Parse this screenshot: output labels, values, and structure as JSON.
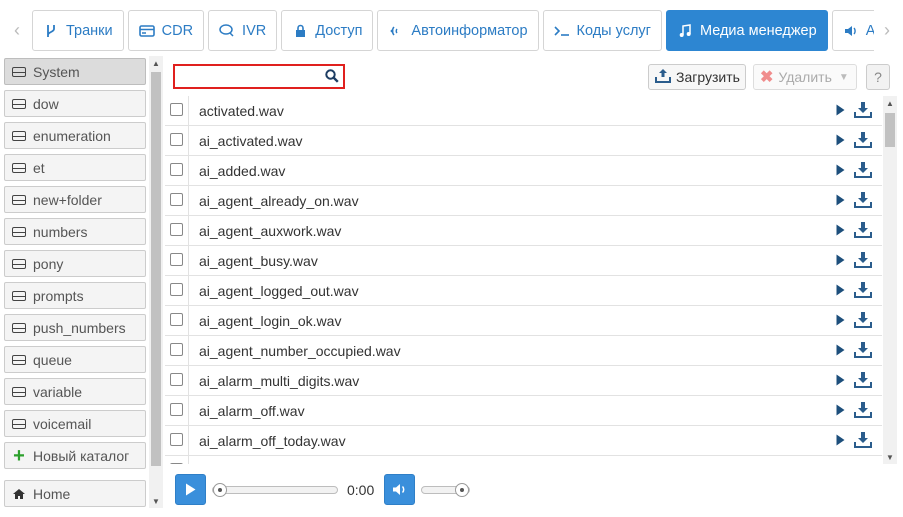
{
  "tabs": [
    {
      "label": "Транки",
      "icon": "fork-icon"
    },
    {
      "label": "CDR",
      "icon": "card-icon"
    },
    {
      "label": "IVR",
      "icon": "chat-icon"
    },
    {
      "label": "Доступ",
      "icon": "lock-icon"
    },
    {
      "label": "Автоинформатор",
      "icon": "phone-wave-icon"
    },
    {
      "label": "Коды услуг",
      "icon": "terminal-icon"
    },
    {
      "label": "Медиа менеджер",
      "icon": "music-note-icon",
      "active": true
    },
    {
      "label": "Акустическ",
      "icon": "volume-icon"
    }
  ],
  "sidebar": {
    "folders": [
      "System",
      "dow",
      "enumeration",
      "et",
      "new+folder",
      "numbers",
      "pony",
      "prompts",
      "push_numbers",
      "queue",
      "variable",
      "voicemail"
    ],
    "selected": "System",
    "new_folder_label": "Новый каталог",
    "home_label": "Home"
  },
  "toolbar": {
    "search_value": "",
    "search_placeholder": "",
    "upload_label": "Загрузить",
    "delete_label": "Удалить",
    "help_label": "?"
  },
  "files": [
    "activated.wav",
    "ai_activated.wav",
    "ai_added.wav",
    "ai_agent_already_on.wav",
    "ai_agent_auxwork.wav",
    "ai_agent_busy.wav",
    "ai_agent_logged_out.wav",
    "ai_agent_login_ok.wav",
    "ai_agent_number_occupied.wav",
    "ai_alarm_multi_digits.wav",
    "ai_alarm_off.wav",
    "ai_alarm_off_today.wav"
  ],
  "player": {
    "time": "0:00",
    "progress": 0,
    "volume": 1.0
  },
  "colors": {
    "accent": "#2d86d2",
    "tab_text": "#2c7cc4",
    "search_border": "#e0201e",
    "play_icon": "#1d4f7c"
  }
}
